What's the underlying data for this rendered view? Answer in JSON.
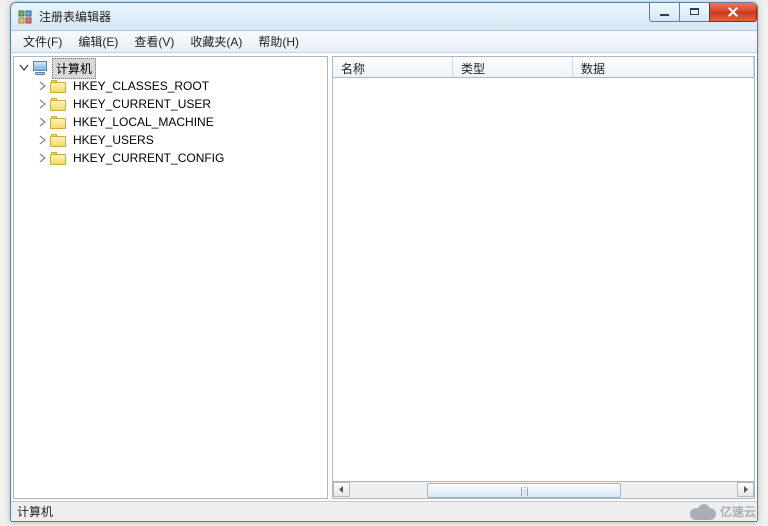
{
  "window": {
    "title": "注册表编辑器"
  },
  "menu": {
    "file": "文件(F)",
    "edit": "编辑(E)",
    "view": "查看(V)",
    "favorites": "收藏夹(A)",
    "help": "帮助(H)"
  },
  "tree": {
    "root_label": "计算机",
    "items": [
      {
        "label": "HKEY_CLASSES_ROOT"
      },
      {
        "label": "HKEY_CURRENT_USER"
      },
      {
        "label": "HKEY_LOCAL_MACHINE"
      },
      {
        "label": "HKEY_USERS"
      },
      {
        "label": "HKEY_CURRENT_CONFIG"
      }
    ]
  },
  "columns": {
    "name": "名称",
    "type": "类型",
    "data": "数据"
  },
  "statusbar": {
    "path": "计算机"
  },
  "watermark": {
    "text": "亿速云"
  }
}
